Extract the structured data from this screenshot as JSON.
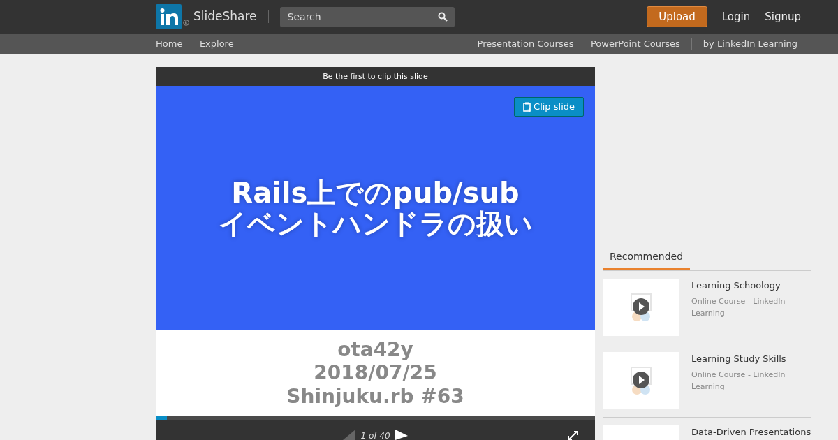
{
  "header": {
    "brand": "SlideShare",
    "search": {
      "placeholder": "Search"
    },
    "upload": "Upload",
    "links": [
      "Login",
      "Signup"
    ]
  },
  "subnav": {
    "left": [
      "Home",
      "Explore"
    ],
    "right": [
      "Presentation Courses",
      "PowerPoint Courses"
    ],
    "extra": "by LinkedIn Learning"
  },
  "player": {
    "clip_bar": "Be the first to clip this slide",
    "clip_button": "Clip slide",
    "slide": {
      "title_lines": [
        "Rails上でのpub/sub",
        "イベントハンドラの扱い"
      ],
      "info_lines": [
        "ota42y",
        "2018/07/25",
        "Shinjuku.rb #63"
      ]
    },
    "progress": {
      "level": 0.025
    },
    "page": "1 of 40"
  },
  "recommended": {
    "tab": "Recommended",
    "items": [
      {
        "title": "Learning Schoology",
        "subtitle": "Online Course - LinkedIn Learning"
      },
      {
        "title": "Learning Study Skills",
        "subtitle": "Online Course - LinkedIn Learning"
      },
      {
        "title": "Data-Driven Presentations"
      }
    ]
  }
}
